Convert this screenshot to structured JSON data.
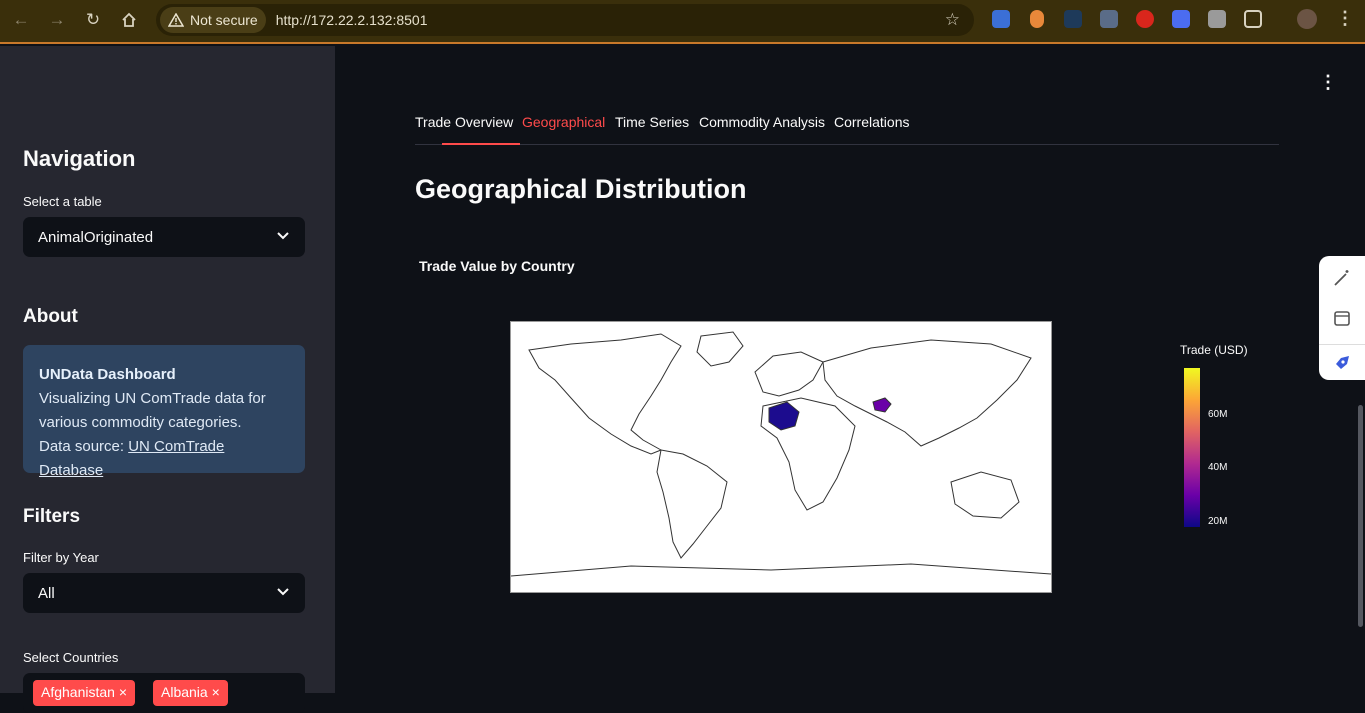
{
  "browser": {
    "security_label": "Not secure",
    "url": "http://172.22.2.132:8501"
  },
  "sidebar": {
    "nav_heading": "Navigation",
    "table_label": "Select a table",
    "table_value": "AnimalOriginated",
    "about_heading": "About",
    "about_title": "UNData Dashboard",
    "about_text": "Visualizing UN ComTrade data for various commodity categories.",
    "about_source_prefix": "Data source: ",
    "about_source_link": "UN ComTrade Database",
    "filters_heading": "Filters",
    "year_label": "Filter by Year",
    "year_value": "All",
    "countries_label": "Select Countries",
    "countries_selected": [
      "Afghanistan",
      "Albania"
    ]
  },
  "main": {
    "tabs": [
      {
        "label": "Trade Overview",
        "active": false
      },
      {
        "label": "Geographical",
        "active": true
      },
      {
        "label": "Time Series",
        "active": false
      },
      {
        "label": "Commodity Analysis",
        "active": false
      },
      {
        "label": "Correlations",
        "active": false
      }
    ],
    "heading": "Geographical Distribution"
  },
  "chart_data": {
    "type": "choropleth",
    "title": "Trade Value by Country",
    "colorbar_title": "Trade (USD)",
    "colorbar_ticks": [
      "60M",
      "40M",
      "20M"
    ],
    "colorscale": [
      "#0d0887",
      "#6a00a8",
      "#b12a90",
      "#e16462",
      "#fca636",
      "#f0f921"
    ],
    "regions": [
      {
        "name": "Algeria",
        "color": "#1c0c8e"
      },
      {
        "name": "Afghanistan",
        "color": "#6a00a8"
      }
    ]
  }
}
